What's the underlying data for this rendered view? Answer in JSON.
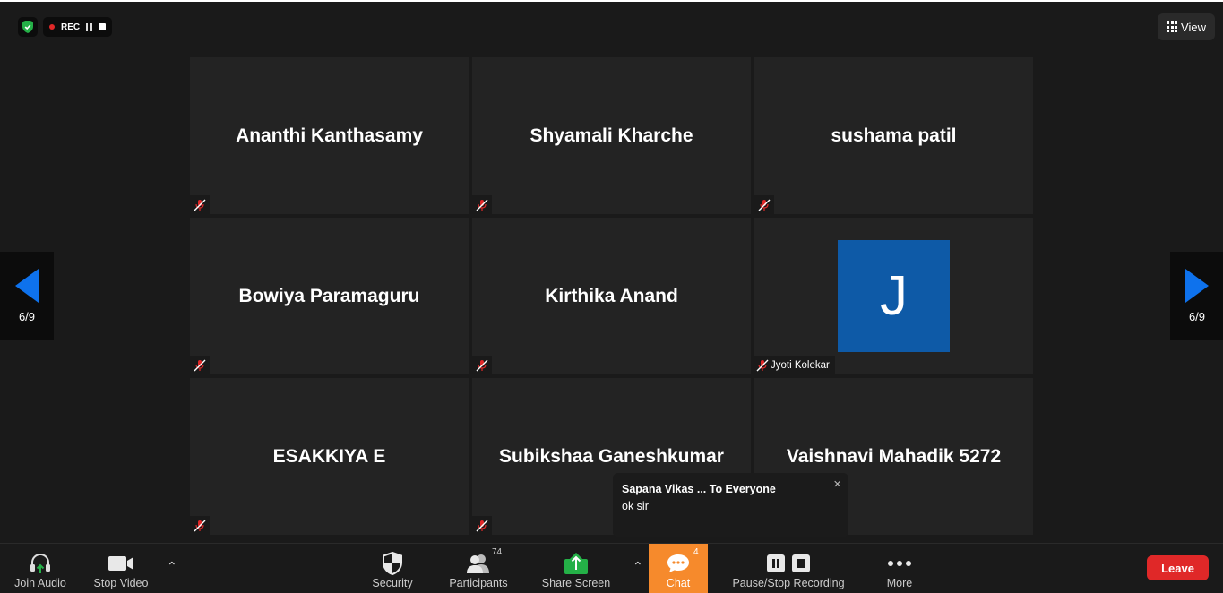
{
  "recording": {
    "label": "REC"
  },
  "view_button": {
    "label": "View"
  },
  "pagination": {
    "left_label": "6/9",
    "right_label": "6/9"
  },
  "participants": [
    {
      "name": "Ananthi Kanthasamy",
      "muted": true
    },
    {
      "name": "Shyamali Kharche",
      "muted": true
    },
    {
      "name": "sushama patil",
      "muted": true
    },
    {
      "name": "Bowiya Paramaguru",
      "muted": true
    },
    {
      "name": "Kirthika Anand",
      "muted": true
    },
    {
      "name": "Jyoti Kolekar",
      "avatar_letter": "J",
      "muted": true
    },
    {
      "name": "ESAKKIYA E",
      "muted": true
    },
    {
      "name": "Subikshaa Ganeshkumar",
      "muted": true
    },
    {
      "name": "Vaishnavi Mahadik 5272",
      "muted": true
    }
  ],
  "chat_popup": {
    "from": "Sapana Vikas ... To Everyone",
    "message": "ok sir",
    "close": "×"
  },
  "toolbar": {
    "join_audio": "Join Audio",
    "stop_video": "Stop Video",
    "security": "Security",
    "participants": "Participants",
    "participants_count": "74",
    "share_screen": "Share Screen",
    "chat": "Chat",
    "chat_count": "4",
    "pause_stop_recording": "Pause/Stop Recording",
    "more": "More",
    "leave": "Leave"
  },
  "colors": {
    "background": "#1a1a1a",
    "tile": "#232323",
    "accent_blue": "#0e72ed",
    "avatar_blue": "#0e5aa7",
    "chat_orange": "#f68a2c",
    "leave_red": "#e02828",
    "share_green": "#24b047",
    "muted_red": "#e02828"
  }
}
